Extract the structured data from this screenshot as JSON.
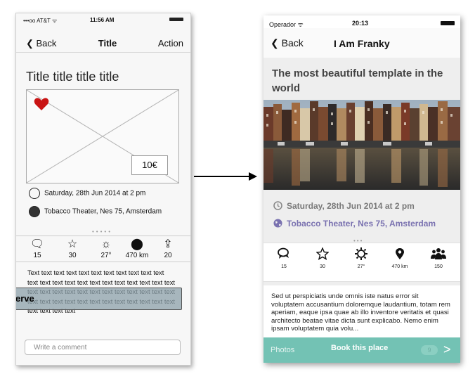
{
  "wireframe": {
    "status": {
      "left": "•••oo AT&T ᯤ",
      "time": "11:56 AM"
    },
    "nav": {
      "back": "Back",
      "title": "Title",
      "action": "Action"
    },
    "big_title": "Title title title title",
    "price": "10€",
    "date": "Saturday, 28th Jun 2014 at 2 pm",
    "location": "Tobacco Theater, Nes 75, Amsterdam",
    "stats": [
      {
        "icon": "chat-icon",
        "value": "15"
      },
      {
        "icon": "star-icon",
        "value": "30"
      },
      {
        "icon": "sun-icon",
        "value": "27°"
      },
      {
        "icon": "pin-icon",
        "value": "470 km"
      },
      {
        "icon": "share-icon",
        "value": "20"
      }
    ],
    "body_text": "Text text text text text text text text text text text text text text text text text text text text text text text text text text text text text text text text text text text text text text text text text text text text text text text text text text text",
    "reserve_label": "erve",
    "comment_placeholder": "Write a comment"
  },
  "phone": {
    "status": {
      "carrier": "Operador ᯤ",
      "time": "20:13"
    },
    "nav": {
      "back": "Back",
      "title": "I Am Franky"
    },
    "heading": "The most beautiful template in the world",
    "date": "Saturday, 28th Jun 2014 at 2 pm",
    "location": "Tobacco Theater, Nes 75, Amsterdam",
    "stats": [
      {
        "icon": "chat-icon",
        "value": "15"
      },
      {
        "icon": "star-icon",
        "value": "30"
      },
      {
        "icon": "sun-icon",
        "value": "27°"
      },
      {
        "icon": "pin-icon",
        "value": "470 km"
      },
      {
        "icon": "group-icon",
        "value": "150"
      }
    ],
    "description": "Sed ut perspiciatis unde omnis iste natus error sit voluptatem accusantium doloremque laudantium, totam rem aperiam, eaque ipsa quae ab illo inventore veritatis et quasi architecto beatae vitae dicta sunt explicabo. Nemo enim ipsam voluptatem quia volu...",
    "bottom_bar": {
      "photos": "Photos",
      "book": "Book this place",
      "badge": "9",
      "chevron": ">"
    },
    "colors": {
      "accent": "#73c2b4",
      "location": "#7a72b0",
      "heading": "#444444"
    }
  }
}
